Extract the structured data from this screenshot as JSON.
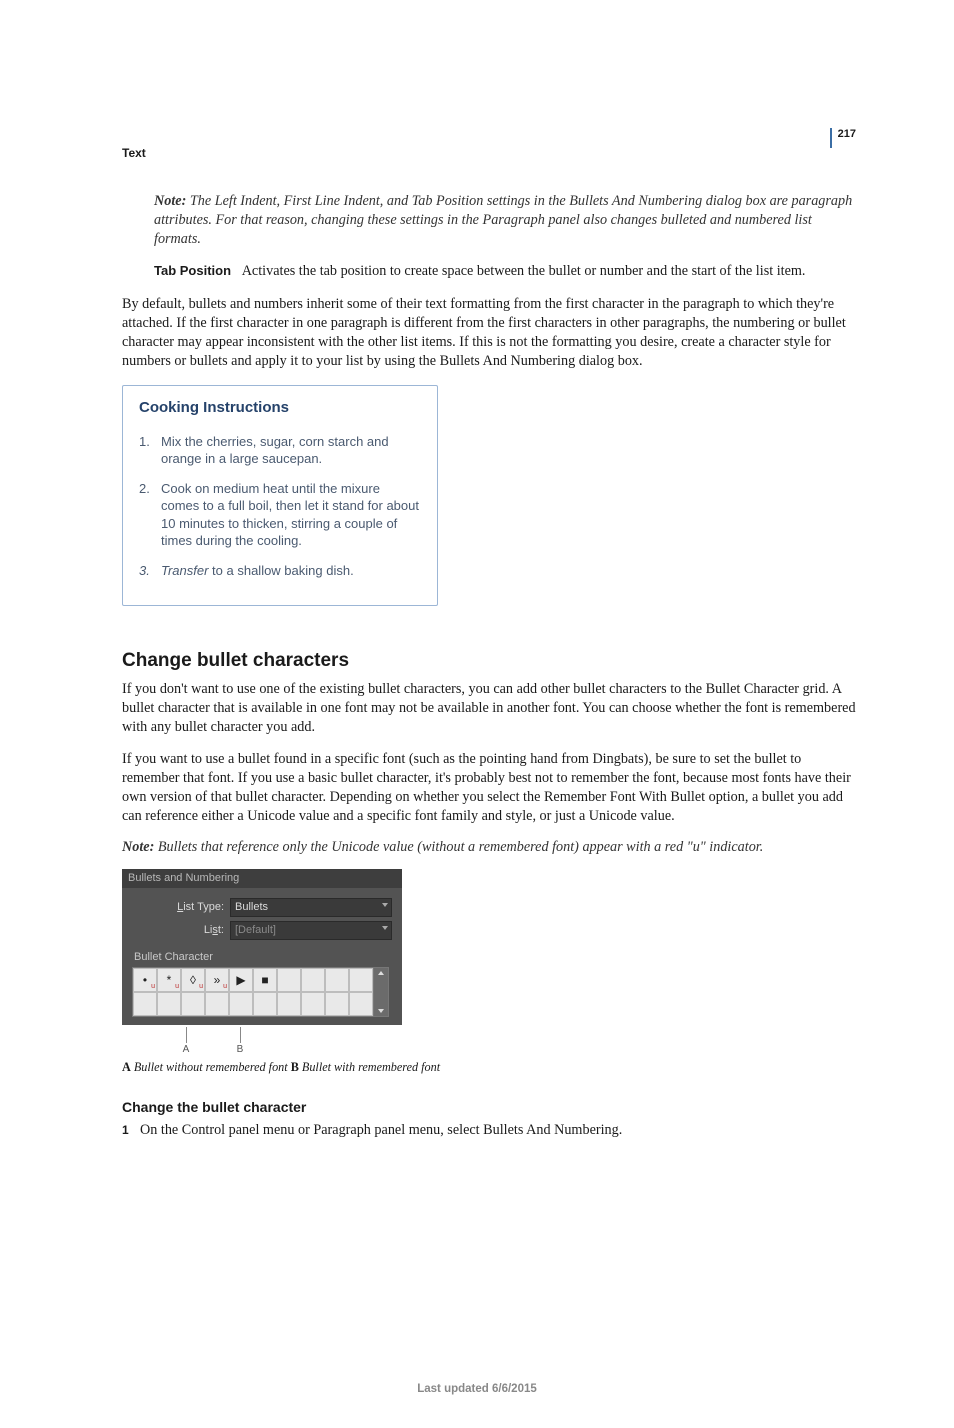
{
  "meta": {
    "section": "Text",
    "page_number": "217",
    "footer": "Last updated 6/6/2015"
  },
  "note1": {
    "label": "Note:",
    "text": "The Left Indent, First Line Indent, and Tab Position settings in the Bullets And Numbering dialog box are paragraph attributes. For that reason, changing these settings in the Paragraph panel also changes bulleted and numbered list formats."
  },
  "term_line": {
    "term": "Tab Position",
    "desc": "Activates the tab position to create space between the bullet or number and the start of the list item."
  },
  "body1": "By default, bullets and numbers inherit some of their text formatting from the first character in the paragraph to which they're attached. If the first character in one paragraph is different from the first characters in other paragraphs, the numbering or bullet character may appear inconsistent with the other list items. If this is not the formatting you desire, create a character style for numbers or bullets and apply it to your list by using the Bullets And Numbering dialog box.",
  "figure1": {
    "title": "Cooking Instructions",
    "items": [
      {
        "n": "1.",
        "t": "Mix the cherries, sugar, corn starch and orange in a large saucepan."
      },
      {
        "n": "2.",
        "t": "Cook on medium heat until the mixure comes to a full boil, then let it stand for about 10 minutes to thicken, stirring a couple of times during the cooling."
      },
      {
        "n": "3.",
        "t_italic_lead": "Transfer",
        "t_rest": " to a shallow baking dish."
      }
    ]
  },
  "heading2": "Change bullet characters",
  "body2": "If you don't want to use one of the existing bullet characters, you can add other bullet characters to the Bullet Character grid. A bullet character that is available in one font may not be available in another font. You can choose whether the font is remembered with any bullet character you add.",
  "body3": "If you want to use a bullet found in a specific font (such as the pointing hand from Dingbats), be sure to set the bullet to remember that font. If you use a basic bullet character, it's probably best not to remember the font, because most fonts have their own version of that bullet character. Depending on whether you select the Remember Font With Bullet option, a bullet you add can reference either a Unicode value and a specific font family and style, or just a Unicode value.",
  "note2": {
    "label": "Note:",
    "text": "Bullets that reference only the Unicode value (without a remembered font) appear with a red \"u\" indicator."
  },
  "figure2": {
    "title": "Bullets and Numbering",
    "list_type_label": "List Type:",
    "list_type_value": "Bullets",
    "list_label": "List:",
    "list_value": "[Default]",
    "bullet_char_label": "Bullet Character",
    "glyphs": [
      "•",
      "*",
      "◊",
      "»",
      "▶",
      "■"
    ],
    "callouts": {
      "A": "A",
      "B": "B"
    }
  },
  "fig2_caption": {
    "a_letter": "A",
    "a_text": " Bullet without remembered font  ",
    "b_letter": "B",
    "b_text": " Bullet with remembered font"
  },
  "sub_heading": "Change the bullet character",
  "step1": {
    "n": "1",
    "t": "On the Control panel menu or Paragraph panel menu, select Bullets And Numbering."
  }
}
